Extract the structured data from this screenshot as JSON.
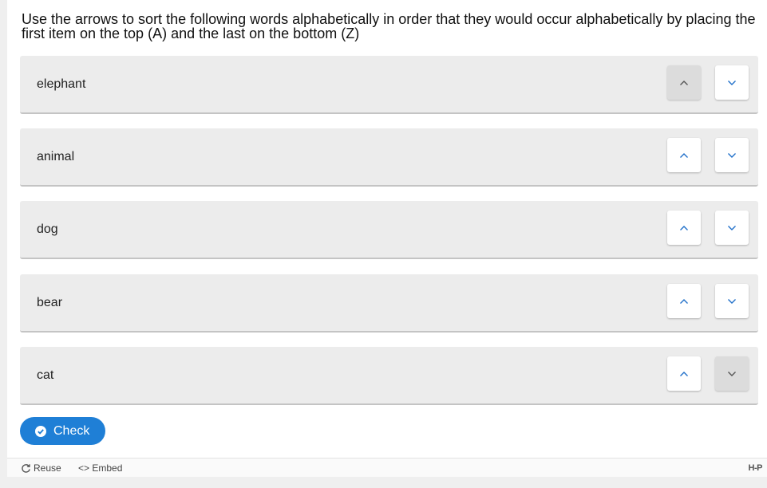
{
  "question": "Use the arrows to sort the following words alphabetically in order that they  would occur alphabetically by placing the first item on the top (A) and the last on the bottom (Z)",
  "items": [
    {
      "label": "elephant",
      "up_disabled": true,
      "down_disabled": false
    },
    {
      "label": "animal",
      "up_disabled": false,
      "down_disabled": false
    },
    {
      "label": "dog",
      "up_disabled": false,
      "down_disabled": false
    },
    {
      "label": "bear",
      "up_disabled": false,
      "down_disabled": false
    },
    {
      "label": "cat",
      "up_disabled": false,
      "down_disabled": true
    }
  ],
  "check_button": {
    "label": "Check",
    "icon": "check-circle-icon"
  },
  "footer": {
    "reuse_label": "Reuse",
    "reuse_icon": "refresh-icon",
    "embed_label": "<> Embed",
    "logo": "H-P"
  },
  "colors": {
    "accent": "#1f7fd6",
    "arrow": "#1f6fc9",
    "item_bg": "#ececec",
    "disabled_bg": "#dcdcdc"
  }
}
